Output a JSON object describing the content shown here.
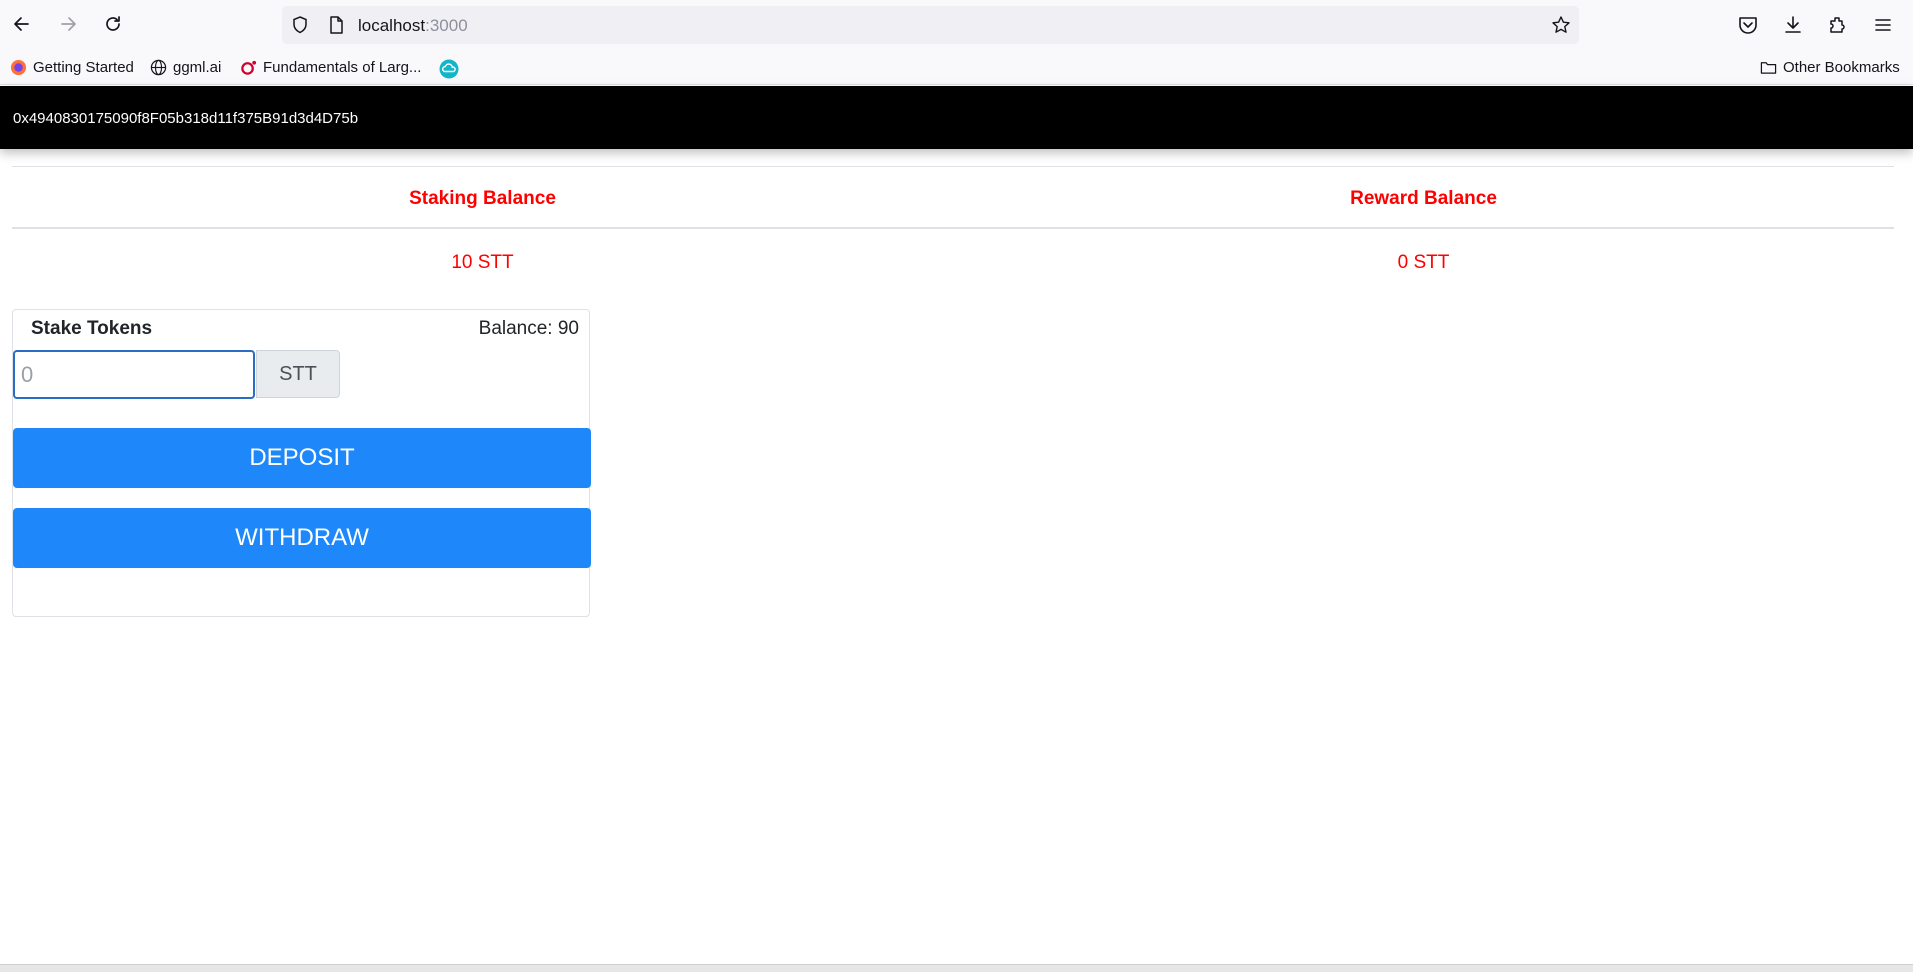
{
  "browser": {
    "url_host": "localhost",
    "url_port": ":3000",
    "bookmarks": [
      {
        "label": "Getting Started",
        "icon": "firefox-icon"
      },
      {
        "label": "ggml.ai",
        "icon": "globe-icon"
      },
      {
        "label": "Fundamentals of Larg...",
        "icon": "oreilly-icon"
      },
      {
        "label": "",
        "icon": "cloud-app-icon"
      }
    ],
    "other_bookmarks": "Other Bookmarks"
  },
  "header": {
    "account": "0x4940830175090f8F05b318d11f375B91d3d4D75b",
    "background": "#000000"
  },
  "balances": {
    "staking_label": "Staking Balance",
    "reward_label": "Reward Balance",
    "staking_value": "10 STT",
    "reward_value": "0 STT",
    "color": "#ff0000"
  },
  "stake_card": {
    "title": "Stake Tokens",
    "balance": "Balance: 90",
    "input_placeholder": "0",
    "unit": "STT",
    "deposit_label": "DEPOSIT",
    "withdraw_label": "WITHDRAW",
    "button_color": "#1e88fb"
  }
}
